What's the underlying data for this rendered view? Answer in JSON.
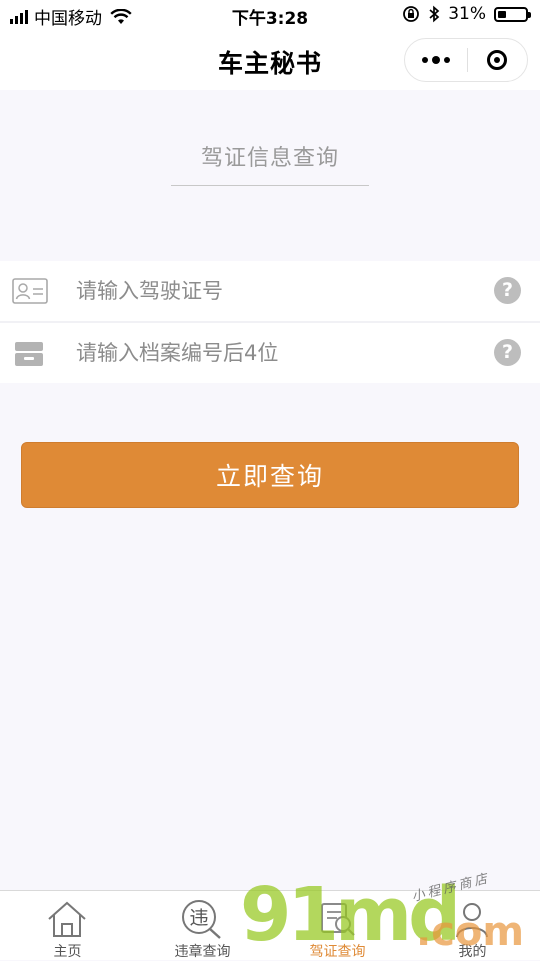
{
  "status_bar": {
    "carrier": "中国移动",
    "time": "下午3:28",
    "battery": "31%",
    "battery_level": 0.31
  },
  "nav": {
    "title": "车主秘书"
  },
  "query": {
    "title": "驾证信息查询",
    "license_placeholder": "请输入驾驶证号",
    "archive_placeholder": "请输入档案编号后4位",
    "help_glyph": "?",
    "submit_label": "立即查询"
  },
  "tabs": [
    {
      "label": "主页",
      "icon": "home-icon"
    },
    {
      "label": "违章查询",
      "icon": "violation-search-icon",
      "glyph": "违"
    },
    {
      "label": "驾证查询",
      "icon": "license-search-icon",
      "active": true
    },
    {
      "label": "我的",
      "icon": "user-icon"
    }
  ],
  "watermark": {
    "brand": "91md",
    "domain": ".com",
    "shop": "小程序商店"
  },
  "colors": {
    "accent": "#df8a36",
    "background": "#f8f7fc",
    "placeholder": "#8c8c8c"
  }
}
